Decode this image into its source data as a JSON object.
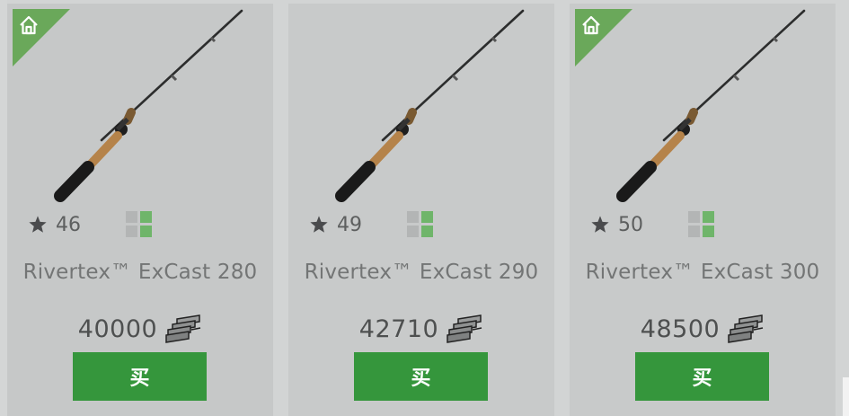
{
  "products": [
    {
      "name": "Rivertex™ ExCast 280",
      "rating": "46",
      "price": "40000",
      "buy_label": "买",
      "owned": true,
      "icons": {
        "rating": "star-icon",
        "slots": "slots-icon",
        "currency": "cash-stack-icon",
        "owned": "home-icon"
      }
    },
    {
      "name": "Rivertex™ ExCast 290",
      "rating": "49",
      "price": "42710",
      "buy_label": "买",
      "owned": false,
      "icons": {
        "rating": "star-icon",
        "slots": "slots-icon",
        "currency": "cash-stack-icon"
      }
    },
    {
      "name": "Rivertex™ ExCast 300",
      "rating": "50",
      "price": "48500",
      "buy_label": "买",
      "owned": true,
      "icons": {
        "rating": "star-icon",
        "slots": "slots-icon",
        "currency": "cash-stack-icon",
        "owned": "home-icon"
      }
    }
  ],
  "colors": {
    "buy_button": "#35963c",
    "owned_badge": "#6aa85a",
    "slot_filled": "#6fb56a",
    "slot_empty": "#b3b5b5",
    "card_background": "#c8caca"
  }
}
